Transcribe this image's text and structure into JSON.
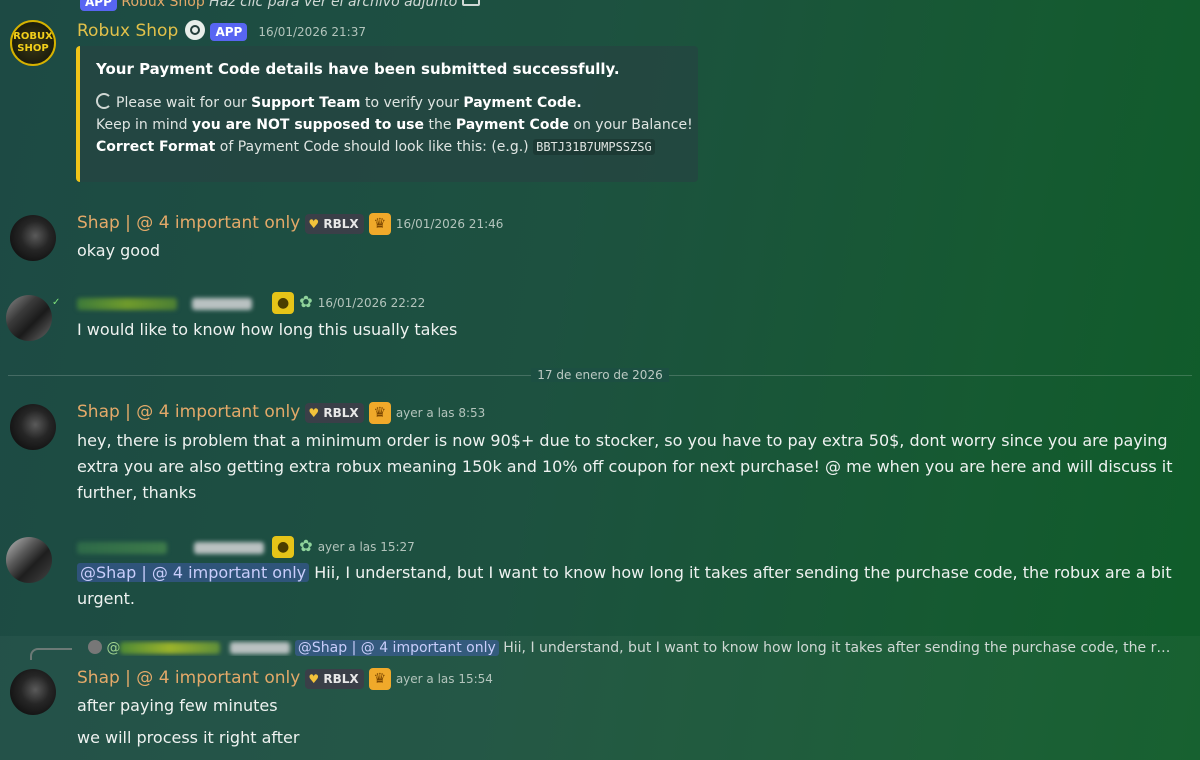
{
  "top_strip": {
    "app": "APP",
    "name": "Robux Shop",
    "text": "Haz clic para ver el archivo adjunto"
  },
  "bot_message": {
    "avatar_text": "ROBUX SHOP",
    "name": "Robux Shop",
    "app_badge": "APP",
    "timestamp": "16/01/2026 21:37",
    "embed": {
      "title": "Your Payment Code details have been submitted successfully.",
      "line1_a": "Please wait for our ",
      "line1_b": "Support Team",
      "line1_c": " to verify your ",
      "line1_d": "Payment Code.",
      "line2_a": "Keep in mind ",
      "line2_b": "you are NOT supposed to use",
      "line2_c": " the ",
      "line2_d": "Payment Code",
      "line2_e": " on your Balance!",
      "line3_a": "Correct Format",
      "line3_b": " of Payment Code should look like this: (e.g.) ",
      "line3_code": "BBTJ31B7UMPSSZSG"
    },
    "accent_color": "#f0c519"
  },
  "messages": [
    {
      "name": "Shap | @ 4 important only",
      "tag": "RBLX",
      "timestamp": "16/01/2026 21:46",
      "text": "okay good"
    },
    {
      "timestamp": "16/01/2026 22:22",
      "text": "I would like to know how long this usually takes"
    },
    {
      "name": "Shap | @ 4 important only",
      "tag": "RBLX",
      "timestamp": "ayer a las 8:53",
      "text": "hey, there is problem that a minimum order is now 90$+ due to stocker, so you have to pay extra 50$, dont worry since you are paying extra you are also getting extra robux meaning 150k and 10% off coupon for next purchase! @ me when you are here and will discuss it further, thanks"
    },
    {
      "timestamp": "ayer a las 15:27",
      "mention": "@Shap | @ 4 important only",
      "text": " Hii, I understand, but I want to know how long it takes after sending the purchase code, the robux are a bit urgent."
    },
    {
      "reply_prefix": "@",
      "reply_mention": "@Shap | @ 4 important only",
      "reply_text": "Hii, I understand, but I want to know how long it takes after sending the purchase code, the r…",
      "name": "Shap | @ 4 important only",
      "tag": "RBLX",
      "timestamp": "ayer a las 15:54",
      "text": "after paying few minutes",
      "text2": "we will process it right after"
    }
  ],
  "divider": "17 de enero de 2026",
  "colors": {
    "name": "#e3a969",
    "mention_bg": "#5865f2",
    "crown": "#f0a92a"
  }
}
